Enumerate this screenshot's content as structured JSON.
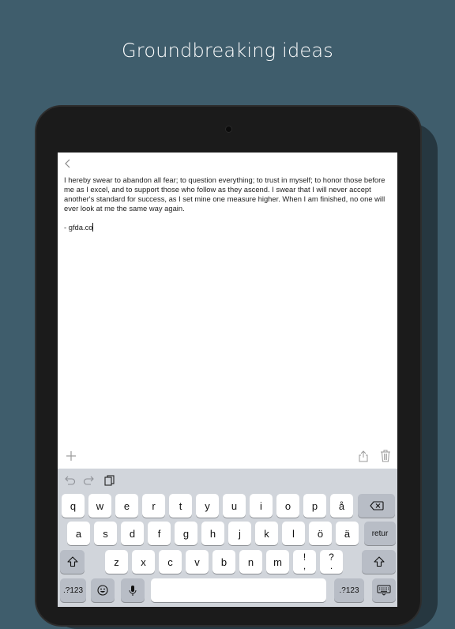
{
  "headline": "Groundbreaking ideas",
  "note": {
    "body": "I hereby swear to abandon all fear; to question everything; to trust in myself; to honor those before me as I excel, and to support those who follow as they ascend. I swear that I will never accept another's standard for success, as I set mine one measure higher. When I am finished, no one will ever look at me the same way again.",
    "signature": "- gfda.co"
  },
  "icons": {
    "back": "chevron-left-icon",
    "add": "plus-icon",
    "share": "share-icon",
    "delete": "trash-icon",
    "undo": "undo-icon",
    "redo": "redo-icon",
    "paste": "paste-icon",
    "shift": "shift-arrow-icon",
    "backspace": "backspace-icon",
    "emoji": "emoji-icon",
    "mic": "microphone-icon",
    "hide_keyboard": "keyboard-hide-icon"
  },
  "keyboard": {
    "row1": [
      "q",
      "w",
      "e",
      "r",
      "t",
      "y",
      "u",
      "i",
      "o",
      "p",
      "å"
    ],
    "row2": [
      "a",
      "s",
      "d",
      "f",
      "g",
      "h",
      "j",
      "k",
      "l",
      "ö",
      "ä"
    ],
    "return_label": "retur",
    "row3": [
      "z",
      "x",
      "c",
      "v",
      "b",
      "n",
      "m"
    ],
    "exclaim": {
      "top": "!",
      "bottom": ","
    },
    "question": {
      "top": "?",
      "bottom": "."
    },
    "numbers_label": ".?123"
  },
  "colors": {
    "background": "#3f5d6c",
    "device": "#1b1b1b",
    "keyboard": "#d1d5db",
    "key": "#ffffff",
    "key_gray": "#b8bdc6"
  }
}
